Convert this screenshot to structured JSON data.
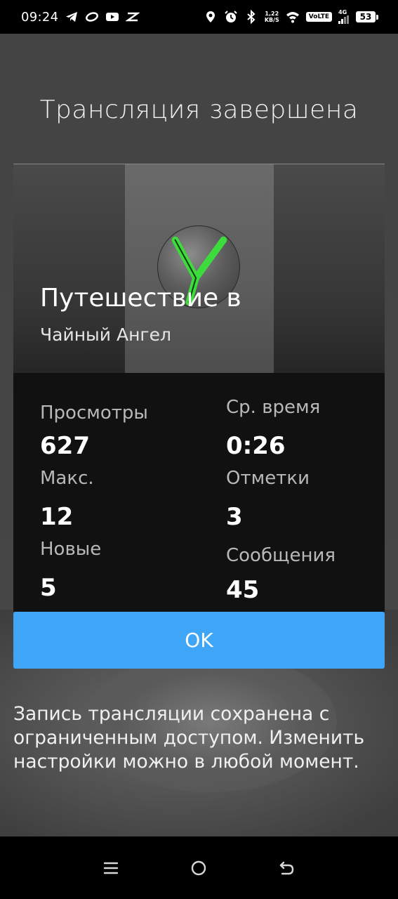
{
  "status_bar": {
    "time": "09:24",
    "net_speed_value": "1,22",
    "net_speed_unit": "KB/S",
    "volte": "VoLTE",
    "network": "4G",
    "battery": "53"
  },
  "dialog": {
    "title": "Трансляция завершена",
    "stream_title": "Путешествие в",
    "author": "Чайный Ангел",
    "stats": [
      {
        "label": "Просмотры",
        "value": "627"
      },
      {
        "label": "Ср. время",
        "value": "0:26"
      },
      {
        "label": "Макс.",
        "value": "12"
      },
      {
        "label": "Отметки",
        "value": "3"
      },
      {
        "label": "Новые",
        "value": "5"
      },
      {
        "label": "Сообщения",
        "value": "45"
      }
    ],
    "ok_label": "OK",
    "note": "Запись трансляции сохранена с ограниченным доступом. Изменить настройки можно в любой момент."
  },
  "nav": {
    "recents_icon": "menu-lines-icon",
    "home_icon": "circle-home-icon",
    "back_icon": "back-arrow-icon"
  },
  "colors": {
    "accent": "#3fa6f7",
    "stats_bg": "#111111",
    "avatar_logo": "#3ddc3d"
  }
}
